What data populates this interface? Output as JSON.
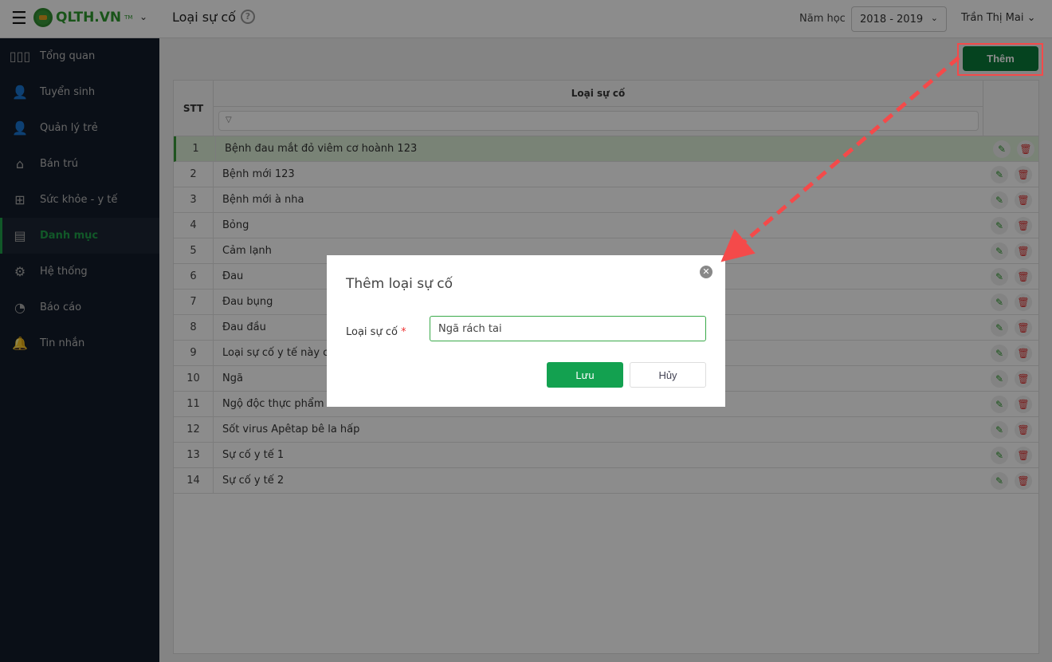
{
  "header": {
    "app_name": "QLTH.VN",
    "tm": "TM",
    "page_title": "Loại sự cố",
    "help": "?",
    "year_label": "Năm học",
    "year_value": "2018 - 2019",
    "user": "Trần Thị Mai"
  },
  "sidebar": {
    "items": [
      {
        "label": "Tổng quan",
        "icon": "bar-chart-icon"
      },
      {
        "label": "Tuyển sinh",
        "icon": "student-icon"
      },
      {
        "label": "Quản lý trẻ",
        "icon": "child-icon"
      },
      {
        "label": "Bán trú",
        "icon": "house-icon"
      },
      {
        "label": "Sức khỏe - y tế",
        "icon": "medical-kit-icon"
      },
      {
        "label": "Danh mục",
        "icon": "folder-icon",
        "active": true
      },
      {
        "label": "Hệ thống",
        "icon": "gear-icon"
      },
      {
        "label": "Báo cáo",
        "icon": "pie-chart-icon"
      },
      {
        "label": "Tin nhắn",
        "icon": "bell-icon"
      }
    ]
  },
  "toolbar": {
    "add_label": "Thêm"
  },
  "table": {
    "col_stt": "STT",
    "col_name": "Loại sự cố",
    "rows": [
      {
        "stt": "1",
        "name": "Bệnh đau mắt đỏ viêm cơ hoành 123"
      },
      {
        "stt": "2",
        "name": "Bệnh mới 123"
      },
      {
        "stt": "3",
        "name": "Bệnh mới à nha"
      },
      {
        "stt": "4",
        "name": "Bỏng"
      },
      {
        "stt": "5",
        "name": "Cảm lạnh"
      },
      {
        "stt": "6",
        "name": "Đau"
      },
      {
        "stt": "7",
        "name": "Đau bụng"
      },
      {
        "stt": "8",
        "name": "Đau đầu"
      },
      {
        "stt": "9",
        "name": "Loại sự cố y tế này có"
      },
      {
        "stt": "10",
        "name": "Ngã"
      },
      {
        "stt": "11",
        "name": "Ngộ độc thực phẩm"
      },
      {
        "stt": "12",
        "name": "Sốt virus Apêtap bê la hấp"
      },
      {
        "stt": "13",
        "name": "Sự cố y tế 1"
      },
      {
        "stt": "14",
        "name": "Sự cố y tế 2"
      }
    ]
  },
  "modal": {
    "title": "Thêm loại sự cố",
    "field_label": "Loại sự cố",
    "required": "*",
    "field_value": "Ngã rách tai",
    "save": "Lưu",
    "cancel": "Hủy"
  },
  "colors": {
    "accent": "#13a150",
    "annotation": "#f44a4a",
    "sidebar_bg": "#131c2a"
  }
}
